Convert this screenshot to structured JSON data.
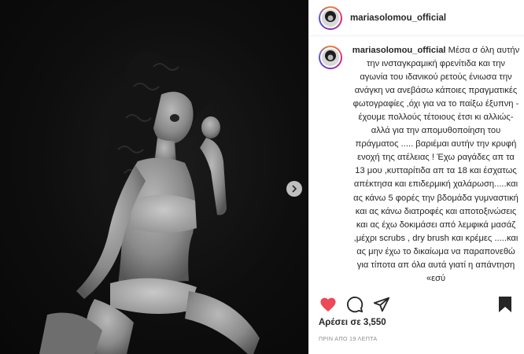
{
  "header": {
    "username": "mariasolomou_official"
  },
  "caption": {
    "username": "mariasolomou_official",
    "text": "Μέσα σ όλη αυτήν την ινσταγκραμική φρενίτιδα και την αγωνία του ιδανικού ρετούς ένιωσα την ανάγκη να ανεβάσω κάποιες πραγματικές φωτογραφίες ,όχι για να το παίξω έξυπνη - έχουμε πολλούς τέτοιους έτσι κι αλλιώς- αλλά για την απομυθοποίηση του πράγματος ..... βαριέμαι αυτήν την κρυφή ενοχή της ατέλειας ! Έχω ραγάδες απ τα 13 μου ,κυτταρίτιδα απ τα 18 και έσχατως απέκτησα και επιδερμική χαλάρωση.....και ας κάνω 5 φορές την βδομάδα γυμναστική και ας κάνω διατροφές και αποτοξινώσεις και ας έχω δοκιμάσει από λεμφικά μασάζ ,μέχρι scrubs , dry brush και κρέμες .....και ας μην έχω το δικαίωμα να παραπονεθώ για τίποτα απ όλα αυτά γιατί η απάντηση «εσύ"
  },
  "likes": {
    "text": "Αρέσει σε 3,550"
  },
  "timestamp": {
    "text": "ΠΡΙΝ ΑΠΟ 19 ΛΕΠΤΑ"
  },
  "icons": {
    "like": "heart-icon",
    "comment": "comment-icon",
    "share": "share-icon",
    "save": "bookmark-icon",
    "next": "chevron-right-icon"
  },
  "colors": {
    "like_active": "#ed4956",
    "text": "#262626",
    "muted": "#8e8e8e"
  }
}
